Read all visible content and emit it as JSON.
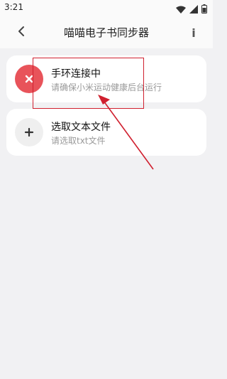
{
  "status_bar": {
    "time": "3:21",
    "icons": [
      "wifi-icon",
      "signal-icon",
      "battery-icon"
    ]
  },
  "app_bar": {
    "title": "喵喵电子书同步器",
    "back_icon": "chevron-left-icon",
    "info_label": "i"
  },
  "cards": [
    {
      "title": "手环连接中",
      "subtitle": "请确保小米运动健康后台运行",
      "icon": "close-icon",
      "icon_color": "#e8535a"
    },
    {
      "title": "选取文本文件",
      "subtitle": "请选取txt文件",
      "icon": "plus-icon",
      "icon_color": "#efefef"
    }
  ],
  "annotation": {
    "color": "#d0202f"
  }
}
